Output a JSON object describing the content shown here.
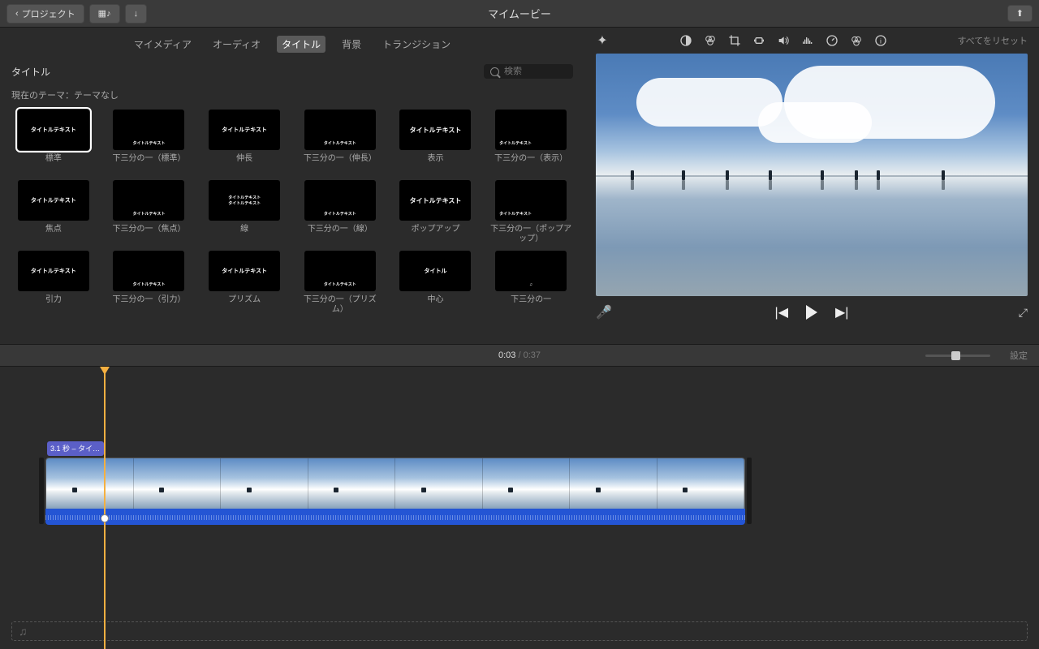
{
  "toolbar": {
    "back_label": "プロジェクト",
    "title": "マイムービー"
  },
  "tabs": {
    "my_media": "マイメディア",
    "audio": "オーディオ",
    "titles": "タイトル",
    "backgrounds": "背景",
    "transitions": "トランジション"
  },
  "browser": {
    "section_title": "タイトル",
    "search_placeholder": "検索",
    "theme_label": "現在のテーマ：テーマなし"
  },
  "title_presets": [
    {
      "name": "標準",
      "preview": "タイトルテキスト",
      "style": "center"
    },
    {
      "name": "下三分の一（標準）",
      "preview": "タイトルテキスト",
      "style": "bottom-small"
    },
    {
      "name": "伸長",
      "preview": "タイトルテキスト",
      "style": "center"
    },
    {
      "name": "下三分の一（伸長）",
      "preview": "タイトルテキスト",
      "style": "bottom-small"
    },
    {
      "name": "表示",
      "preview": "タイトルテキスト",
      "style": "center-bold"
    },
    {
      "name": "下三分の一（表示）",
      "preview": "タイトルテキスト",
      "style": "bottom-left"
    },
    {
      "name": "焦点",
      "preview": "タイトルテキスト",
      "style": "center"
    },
    {
      "name": "下三分の一（焦点）",
      "preview": "タイトルテキスト",
      "style": "bottom-small"
    },
    {
      "name": "線",
      "preview": "タイトルテキスト\nタイトルテキスト",
      "style": "center-double"
    },
    {
      "name": "下三分の一（線）",
      "preview": "タイトルテキスト",
      "style": "bottom-small"
    },
    {
      "name": "ポップアップ",
      "preview": "タイトルテキスト",
      "style": "center-bold"
    },
    {
      "name": "下三分の一（ポップアップ）",
      "preview": "タイトルテキスト",
      "style": "bottom-left"
    },
    {
      "name": "引力",
      "preview": "タイトルテキスト",
      "style": "center"
    },
    {
      "name": "下三分の一（引力）",
      "preview": "タイトルテキスト",
      "style": "bottom-small"
    },
    {
      "name": "プリズム",
      "preview": "タイトルテキスト",
      "style": "center-italic"
    },
    {
      "name": "下三分の一（プリズム）",
      "preview": "タイトルテキスト",
      "style": "bottom-small"
    },
    {
      "name": "中心",
      "preview": "タイトル",
      "style": "center-small"
    },
    {
      "name": "下三分の一",
      "preview": "♫",
      "style": "bottom-icon"
    }
  ],
  "adjustments": {
    "reset_label": "すべてをリセット"
  },
  "time": {
    "current": "0:03",
    "duration": "0:37",
    "settings_label": "設定"
  },
  "timeline": {
    "title_clip_label": "3.1 秒 – タイ…"
  }
}
